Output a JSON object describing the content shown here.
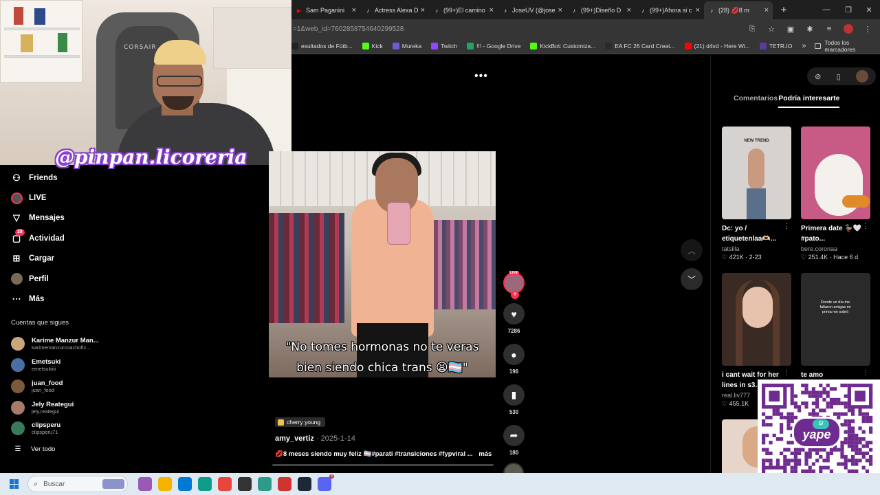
{
  "browser": {
    "tabs": [
      {
        "title": "Sam Paganini",
        "icon": "youtube-icon",
        "active": false
      },
      {
        "title": "Actress Alexa D",
        "icon": "tiktok-icon",
        "active": false
      },
      {
        "title": "(99+)El camino",
        "icon": "tiktok-icon",
        "active": false
      },
      {
        "title": "JoseUV (@jose",
        "icon": "tiktok-icon",
        "active": false
      },
      {
        "title": "(99+)Diseño D",
        "icon": "tiktok-icon",
        "active": false
      },
      {
        "title": "(99+)Ahora si c",
        "icon": "tiktok-icon",
        "active": false
      },
      {
        "title": "(28) 💋8 m",
        "icon": "tiktok-icon",
        "active": true
      }
    ],
    "new_tab": "+",
    "url": "=1&web_id=7602858754640299528",
    "bookmarks": [
      {
        "label": "esultados de Fútb...",
        "color": "#222222"
      },
      {
        "label": "Kick",
        "color": "#53fc18"
      },
      {
        "label": "Mureka",
        "color": "#6b5bd6"
      },
      {
        "label": "Twitch",
        "color": "#9146ff"
      },
      {
        "label": "!!! - Google Drive",
        "color": "#1fa463"
      },
      {
        "label": "KickBot: Customiza...",
        "color": "#53fc18"
      },
      {
        "label": "EA FC 26 Card Creat...",
        "color": "#2a2a2a"
      },
      {
        "label": "(21) d4vd - Here Wi...",
        "color": "#ff0000"
      },
      {
        "label": "TETR.IO",
        "color": "#5a3d9a"
      }
    ],
    "bookmarks_more": "»",
    "all_bookmarks": "Todos los marcadores"
  },
  "overlay": {
    "channel_tag": "@pinpan.licoreria",
    "chair_brand": "CORSAIR"
  },
  "sidebar": {
    "items": [
      {
        "label": "Friends",
        "icon": "friends-icon"
      },
      {
        "label": "LIVE",
        "icon": "live-icon"
      },
      {
        "label": "Mensajes",
        "icon": "messages-icon"
      },
      {
        "label": "Actividad",
        "icon": "activity-icon",
        "badge": "28"
      },
      {
        "label": "Cargar",
        "icon": "upload-icon"
      },
      {
        "label": "Perfil",
        "icon": "profile-icon"
      },
      {
        "label": "Más",
        "icon": "more-icon"
      }
    ],
    "following_title": "Cuentas que sigues",
    "following": [
      {
        "name": "Karime Manzur Man...",
        "handle": "karimemanzurcoachofic...",
        "color": "#c9a77c"
      },
      {
        "name": "Emetsuki",
        "handle": "emetsukiiii",
        "color": "#4a6fa8"
      },
      {
        "name": "juan_food",
        "handle": "juan_food",
        "color": "#7a5a3a"
      },
      {
        "name": "Jely Reategui",
        "handle": "jely.reategui",
        "color": "#a87a6a"
      },
      {
        "name": "clipsperu",
        "handle": "clipsperu71",
        "color": "#3a7a5a"
      }
    ],
    "see_all": "Ver todo"
  },
  "video": {
    "caption_line1": "\"No tomes hormonas no te veras",
    "caption_line2": "bien siendo chica trans 😫🏳️‍⚧️\"",
    "sound": "cherry young",
    "author": "amy_vertiz",
    "date": "2025-1-14",
    "description": "💋8 meses siendo muy feliz 🏳️‍⚧️#parati #transiciones #fypviral ...",
    "more": "más",
    "progress": 0.0,
    "more_options": "•••"
  },
  "actions": {
    "live_badge": "LIVE",
    "follow_plus": "+",
    "likes": "7286",
    "comments": "196",
    "saves": "530",
    "shares": "180"
  },
  "right_panel": {
    "tab_comments": "Comentarios",
    "tab_suggested": "Podría interesarte",
    "cards": [
      {
        "title": "Dc: yo / etiquetenlaa🫶🏻...",
        "author": "tatsilla",
        "likes": "421K",
        "date": "2-23",
        "bg": "#d6d2cf",
        "overlay_text": "NEW TREND"
      },
      {
        "title": "Primera date 🦆🤍 #pato...",
        "author": "bere.coronaa",
        "likes": "251.4K",
        "date": "Hace 6 d",
        "bg": "#c85a86",
        "overlay_text": ""
      },
      {
        "title": "i cant wait for her lines in s3...",
        "author": "real.liv777",
        "likes": "455.1K",
        "date": "",
        "bg": "#3a2a24",
        "overlay_text": ""
      },
      {
        "title": "te amo",
        "author": "",
        "likes": "",
        "date": "",
        "bg": "#2a2a2a",
        "overlay_text": "Donde un día me faltaron amigas mi prima me sobró"
      },
      {
        "title": "",
        "author": "",
        "likes": "",
        "date": "",
        "bg": "#e6d5c8",
        "overlay_text": ""
      }
    ]
  },
  "qr": {
    "brand": "yape",
    "currency": "S/"
  },
  "taskbar": {
    "search_placeholder": "Buscar",
    "apps": [
      {
        "name": "ai-app",
        "color": "#9b59b6"
      },
      {
        "name": "file-explorer",
        "color": "#f4b400"
      },
      {
        "name": "store",
        "color": "#0078d4"
      },
      {
        "name": "edge",
        "color": "#0f9d8a"
      },
      {
        "name": "chrome",
        "color": "#e8453c"
      },
      {
        "name": "obs",
        "color": "#333333"
      },
      {
        "name": "notepad",
        "color": "#2e9b8a"
      },
      {
        "name": "recorder",
        "color": "#d0342c"
      },
      {
        "name": "steam",
        "color": "#1b2838"
      },
      {
        "name": "discord",
        "color": "#5865f2",
        "badge": "3"
      }
    ]
  }
}
